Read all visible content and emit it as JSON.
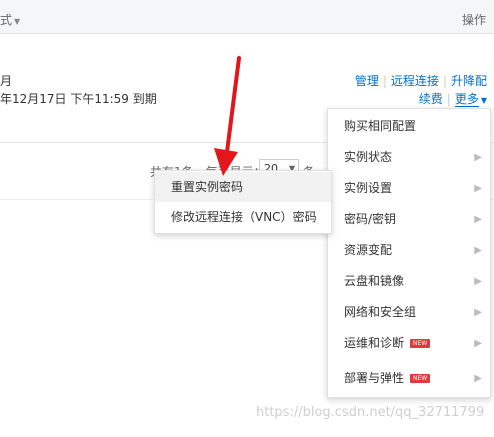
{
  "header": {
    "column_left": "式",
    "column_right": "操作"
  },
  "row": {
    "line1": "月",
    "line2": "年12月17日 下午11:59 到期",
    "ops": {
      "manage": "管理",
      "remote": "远程连接",
      "upgrade": "升降配",
      "renew": "续费",
      "more": "更多"
    }
  },
  "pager": {
    "text": "共有1条，每页显示：",
    "select_value": "20",
    "tail": "条"
  },
  "main_menu": {
    "items": [
      {
        "label": "购买相同配置",
        "arrow": false,
        "badge": ""
      },
      {
        "label": "实例状态",
        "arrow": true,
        "badge": ""
      },
      {
        "label": "实例设置",
        "arrow": true,
        "badge": ""
      },
      {
        "label": "密码/密钥",
        "arrow": true,
        "badge": ""
      },
      {
        "label": "资源变配",
        "arrow": true,
        "badge": ""
      },
      {
        "label": "云盘和镜像",
        "arrow": true,
        "badge": ""
      },
      {
        "label": "网络和安全组",
        "arrow": true,
        "badge": ""
      },
      {
        "label": "运维和诊断",
        "arrow": true,
        "badge": "NEW"
      },
      {
        "label": "部署与弹性",
        "arrow": true,
        "badge": "NEW"
      }
    ]
  },
  "submenu": {
    "items": [
      {
        "label": "重置实例密码"
      },
      {
        "label": "修改远程连接（VNC）密码"
      }
    ]
  },
  "annotation": {
    "arrow_color": "#e3161c"
  },
  "watermark": "https://blog.csdn.net/qq_32711799"
}
